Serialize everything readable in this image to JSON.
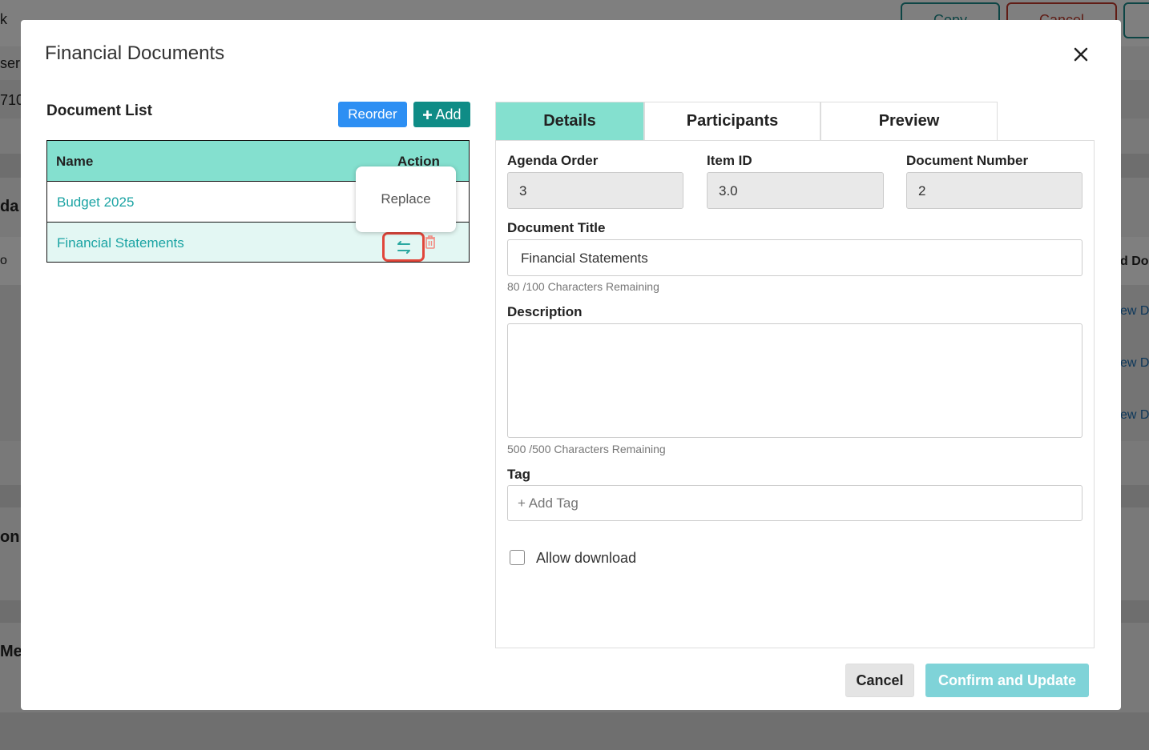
{
  "background": {
    "fragments": [
      "k",
      "ser",
      "710",
      "da",
      "o",
      "on",
      "Med"
    ],
    "header_buttons": [
      "Copy",
      "Cancel"
    ],
    "right_fragments": [
      "d Do",
      "ew Do",
      "ew Do",
      "ew Do"
    ]
  },
  "modal": {
    "title": "Financial Documents",
    "close_icon": "close-icon"
  },
  "document_list": {
    "title": "Document List",
    "reorder_label": "Reorder",
    "add_label": "Add",
    "columns": [
      "Name",
      "Action"
    ],
    "rows": [
      {
        "name": "Budget 2025"
      },
      {
        "name": "Financial Statements",
        "selected": true
      }
    ],
    "tooltip": "Replace"
  },
  "tabs": [
    {
      "label": "Details",
      "active": true
    },
    {
      "label": "Participants",
      "active": false
    },
    {
      "label": "Preview",
      "active": false
    }
  ],
  "details": {
    "agenda_order_label": "Agenda Order",
    "agenda_order_value": "3",
    "item_id_label": "Item ID",
    "item_id_value": "3.0",
    "document_number_label": "Document Number",
    "document_number_value": "2",
    "document_title_label": "Document Title",
    "document_title_value": "Financial Statements",
    "title_chars_remaining": "80 /100 Characters Remaining",
    "description_label": "Description",
    "description_value": "",
    "description_chars_remaining": "500 /500 Characters Remaining",
    "tag_label": "Tag",
    "tag_placeholder": "+ Add Tag",
    "allow_download_label": "Allow download",
    "allow_download_checked": false
  },
  "footer": {
    "cancel_label": "Cancel",
    "confirm_label": "Confirm and Update"
  },
  "colors": {
    "accent_teal": "#84e0cf",
    "link_teal": "#1aa3a3",
    "reorder_blue": "#2d8ff3",
    "add_green": "#0f8c86",
    "confirm_disabled": "#7fd3d8",
    "highlight_red": "#e1463a"
  }
}
